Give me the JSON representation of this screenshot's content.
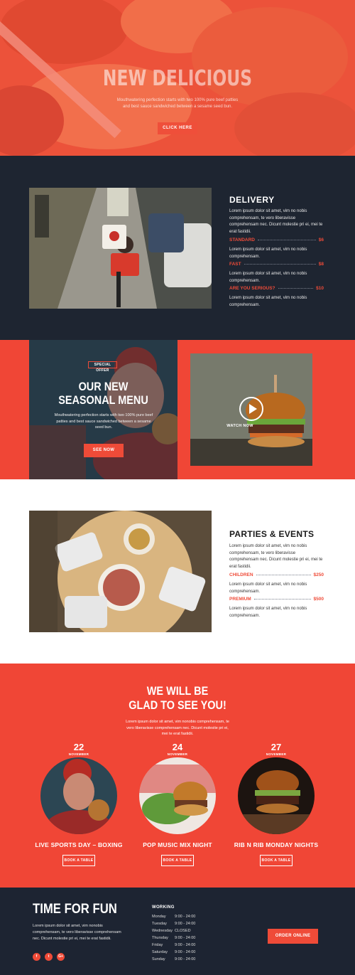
{
  "hero": {
    "title": "NEW DELICIOUS",
    "subtitle": "Mouthwatering perfection starts with two 100% pure beef patties and best sauce sandwiched between a sesame seed bun.",
    "button": "CLICK HERE"
  },
  "delivery": {
    "title": "DELIVERY",
    "description": "Lorem ipsum dolor sit amet, vim no nobis comprehensam, te vero liberavisse comprehensam nec. Dicunt molestie pri ei, mei te erat fastidii.",
    "options": [
      {
        "name": "STANDARD",
        "price": "$6",
        "description": "Lorem ipsum dolor sit amet, vim no nobis comprehensam."
      },
      {
        "name": "FAST",
        "price": "$8",
        "description": "Lorem ipsum dolor sit amet, vim no nobis comprehensam."
      },
      {
        "name": "ARE YOU SERIOUS?",
        "price": "$10",
        "description": "Lorem ipsum dolor sit amet, vim no nobis comprehensam."
      }
    ]
  },
  "seasonal": {
    "badge": "SPECIAL OFFER",
    "title_line1": "OUR NEW",
    "title_line2": "SEASONAL MENU",
    "description": "Mouthwatering perfection starts with two 100% pure beef patties and best sauce sandwiched between a sesame seed bun.",
    "button": "SEE NOW",
    "video_label": "WATCH NOW"
  },
  "parties": {
    "title": "PARTIES & EVENTS",
    "description": "Lorem ipsum dolor sit amet, vim no nobis comprehensam, te vero liberavisse comprehensam nec. Dicunt molestie pri ei, mei te erat fastidii.",
    "options": [
      {
        "name": "CHILDREN",
        "price": "$250",
        "description": "Lorem ipsum dolor sit amet, vim no nobis comprehensam."
      },
      {
        "name": "PREMIUM",
        "price": "$500",
        "description": "Lorem ipsum dolor sit amet, vim no nobis comprehensam."
      }
    ]
  },
  "glad": {
    "title_line1": "WE WILL BE",
    "title_line2": "GLAD TO SEE YOU!",
    "description": "Lorem ipsum dolor sit amet, vim nonobis comprehensam, te vero liberavisse comprehensam nec. Dicunt molestie pri ei, mei te erat fastidii.",
    "events": [
      {
        "day": "22",
        "month": "NOVEMBER",
        "name": "LIVE SPORTS DAY – BOXING",
        "button": "BOOK A TABLE"
      },
      {
        "day": "24",
        "month": "NOVEMBER",
        "name": "POP MUSIC MIX NIGHT",
        "button": "BOOK A TABLE"
      },
      {
        "day": "27",
        "month": "NOVEMBER",
        "name": "RIB N RIB MONDAY NIGHTS",
        "button": "BOOK A TABLE"
      }
    ]
  },
  "footer": {
    "title": "TIME FOR FUN",
    "description": "Lorem ipsum dolor sit amet, vim nonobis comprehensam, te vero liberavisse comprehensam nec. Dicunt molestie pri ei, mei te erat fastidii.",
    "socials": [
      {
        "label": "f",
        "icon": "facebook-icon"
      },
      {
        "label": "t",
        "icon": "twitter-icon"
      },
      {
        "label": "G+",
        "icon": "google-plus-icon"
      }
    ],
    "working_label": "WORKING",
    "hours": [
      {
        "day": "Monday",
        "time": "9:00 - 24:00"
      },
      {
        "day": "Tuesday",
        "time": "9:00 - 24:00"
      },
      {
        "day": "Wednesday",
        "time": "CLOSED"
      },
      {
        "day": "Thursday",
        "time": "9:00 - 24:00"
      },
      {
        "day": "Friday",
        "time": "9:00 - 24:00"
      },
      {
        "day": "Saturday",
        "time": "9:00 - 24:00"
      },
      {
        "day": "Sunday",
        "time": "9:00 - 24:00"
      }
    ],
    "order_button": "ORDER ONLINE"
  },
  "colors": {
    "accent": "#ef4b38",
    "dark": "#1e2531",
    "red_section": "#f04636"
  }
}
